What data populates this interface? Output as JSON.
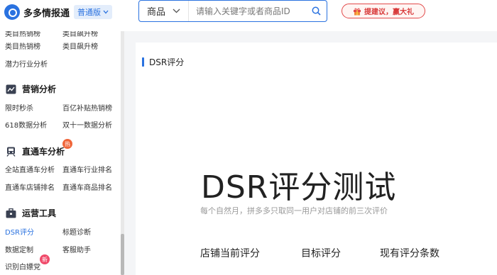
{
  "header": {
    "logo_text": "多多情报通",
    "edition_label": "普通版",
    "search_category": "商品",
    "search_placeholder": "请输入关键字或者商品ID",
    "suggest_label": "提建议，赢大礼"
  },
  "sidebar": {
    "rows_top": [
      {
        "c1": "类目热销榜",
        "c2": "类目飙升榜"
      },
      {
        "c1": "潜力行业分析",
        "c2": ""
      }
    ],
    "sections": [
      {
        "title": "营销分析",
        "icon": "marketing-icon",
        "rows": [
          {
            "c1": "限时秒杀",
            "c2": "百亿补贴热销榜"
          },
          {
            "c1": "618数据分析",
            "c2": "双十一数据分析"
          }
        ]
      },
      {
        "title": "直通车分析",
        "icon": "train-icon",
        "badge": "热",
        "rows": [
          {
            "c1": "全站直通车分析",
            "c2": "直通车行业排名"
          },
          {
            "c1": "直通车店铺排名",
            "c2": "直通车商品排名"
          }
        ]
      },
      {
        "title": "运营工具",
        "icon": "toolbox-icon",
        "rows": [
          {
            "c1": "DSR评分",
            "c2": "标题诊断"
          },
          {
            "c1": "数据定制",
            "c2": "客服助手"
          },
          {
            "c1": "识别白嫖党",
            "c2": "",
            "badge": "新"
          }
        ]
      }
    ]
  },
  "content": {
    "title": "DSR评分",
    "hero_title": "DSR评分测试",
    "hero_subtitle": "每个自然月，拼多多只取同一用户对店铺的前三次评价",
    "metrics": [
      "店铺当前评分",
      "目标评分",
      "现有评分条数"
    ]
  },
  "colors": {
    "accent": "#2a72e0",
    "badge_hot": "#f0663a",
    "badge_new": "#f04a6a",
    "suggest": "#d83a3a"
  }
}
